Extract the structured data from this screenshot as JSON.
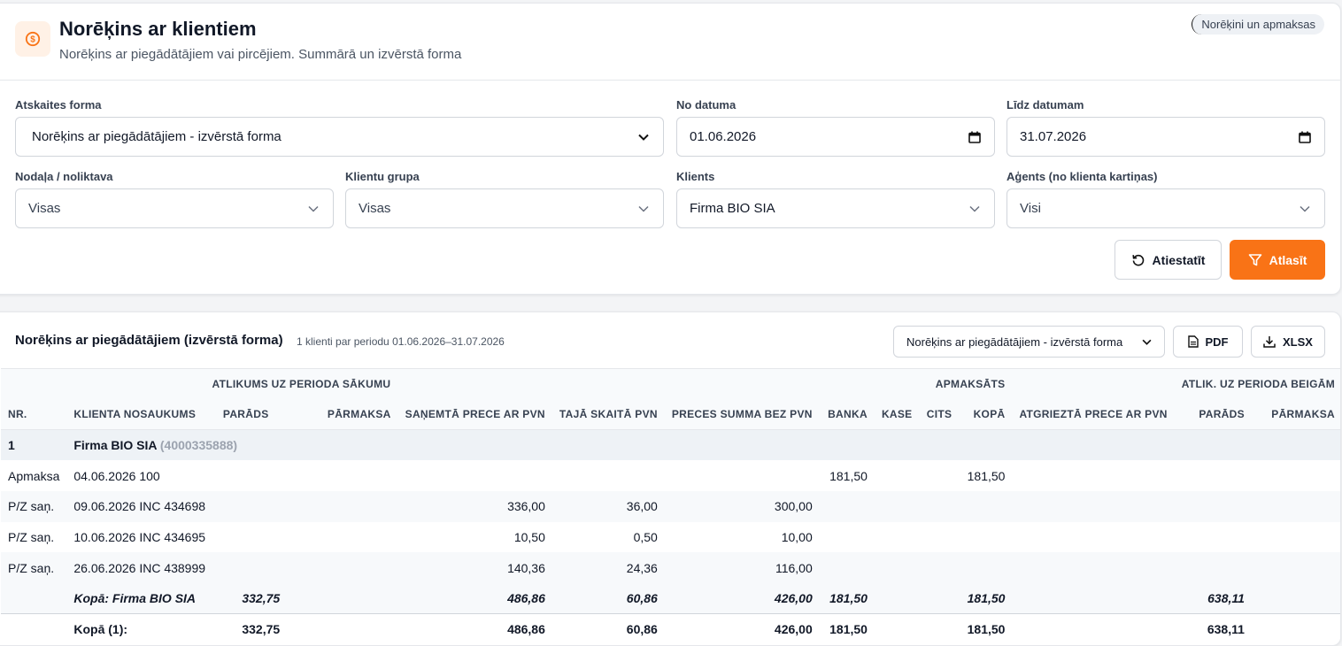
{
  "header": {
    "title": "Norēķins ar klientiem",
    "subtitle": "Norēķins ar piegādātājiem vai pircējiem. Summārā un izvērstā forma",
    "module_badge": "Norēķini un apmaksas",
    "icon": "dollar-circle-icon"
  },
  "filters": {
    "report_form": {
      "label": "Atskaites forma",
      "value": "Norēķins ar piegādātājiem - izvērstā forma"
    },
    "date_from": {
      "label": "No datuma",
      "value": "01.06.2026"
    },
    "date_to": {
      "label": "Līdz datumam",
      "value": "31.07.2026"
    },
    "department": {
      "label": "Nodaļa / noliktava",
      "value": "Visas"
    },
    "client_group": {
      "label": "Klientu grupa",
      "value": "Visas"
    },
    "client": {
      "label": "Klients",
      "value": "Firma BIO SIA"
    },
    "agent": {
      "label": "Aģents (no klienta kartiņas)",
      "value": "Visi"
    },
    "reset_label": "Atiestatīt",
    "apply_label": "Atlasīt"
  },
  "report": {
    "title": "Norēķins ar piegādātājiem (izvērstā forma)",
    "meta": "1 klienti par periodu 01.06.2026–31.07.2026",
    "form_select": "Norēķins ar piegādātājiem - izvērstā forma",
    "pdf_label": "PDF",
    "xlsx_label": "XLSX",
    "group_headers": {
      "start_balance": "ATLIKUMS UZ PERIODA SĀKUMU",
      "paid": "APMAKSĀTS",
      "end_balance": "ATLIK. UZ PERIODA BEIGĀM"
    },
    "columns": {
      "nr": "NR.",
      "client_name": "KLIENTA NOSAUKUMS",
      "debt": "PARĀDS",
      "overpay": "PĀRMAKSA",
      "received": "SAŅEMTĀ PRECE AR PVN",
      "vat": "TAJĀ SKAITĀ PVN",
      "net": "PRECES SUMMA BEZ PVN",
      "bank": "BANKA",
      "cash": "KASE",
      "other": "CITS",
      "total": "KOPĀ",
      "returned": "ATGRIEZTĀ PRECE AR PVN",
      "end_debt": "PARĀDS",
      "end_overpay": "PĀRMAKSA"
    },
    "group": {
      "nr": "1",
      "name": "Firma BIO SIA",
      "code": "(4000335888)"
    },
    "rows": [
      {
        "type": "Apmaksa",
        "doc": "04.06.2026 100",
        "bank": "181,50",
        "total": "181,50"
      },
      {
        "type": "P/Z saņ.",
        "doc": "09.06.2026 INC 434698",
        "received": "336,00",
        "vat": "36,00",
        "net": "300,00"
      },
      {
        "type": "P/Z saņ.",
        "doc": "10.06.2026 INC 434695",
        "received": "10,50",
        "vat": "0,50",
        "net": "10,00"
      },
      {
        "type": "P/Z saņ.",
        "doc": "26.06.2026 INC 438999",
        "received": "140,36",
        "vat": "24,36",
        "net": "116,00"
      }
    ],
    "subtotal": {
      "label": "Kopā: Firma BIO SIA",
      "debt": "332,75",
      "received": "486,86",
      "vat": "60,86",
      "net": "426,00",
      "bank": "181,50",
      "total": "181,50",
      "end_debt": "638,11"
    },
    "grand_total": {
      "label": "Kopā (1):",
      "debt": "332,75",
      "received": "486,86",
      "vat": "60,86",
      "net": "426,00",
      "bank": "181,50",
      "total": "181,50",
      "end_debt": "638,11"
    }
  }
}
